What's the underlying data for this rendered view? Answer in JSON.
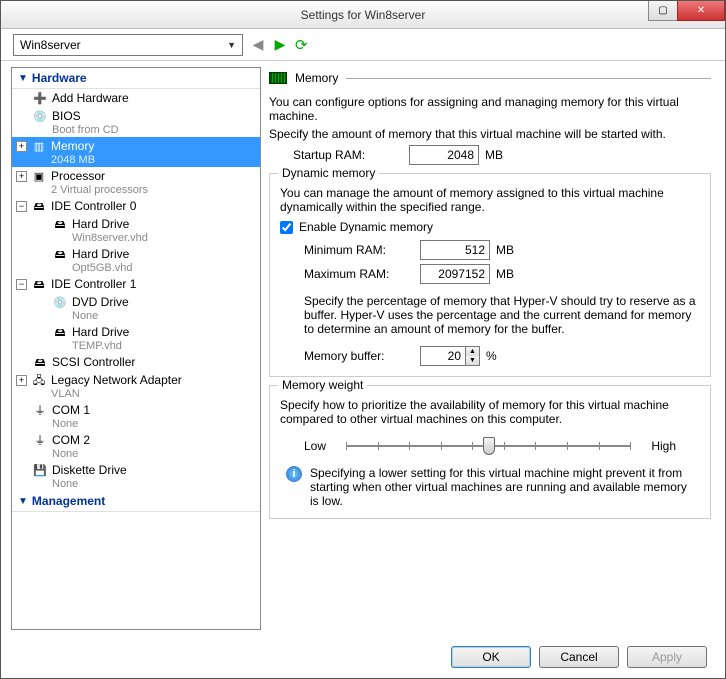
{
  "window": {
    "title": "Settings for Win8server"
  },
  "toolbar": {
    "vm_name": "Win8server"
  },
  "tree": {
    "hardware_label": "Hardware",
    "management_label": "Management",
    "add_hardware": "Add Hardware",
    "bios": "BIOS",
    "bios_sub": "Boot from CD",
    "memory": "Memory",
    "memory_sub": "2048 MB",
    "processor": "Processor",
    "processor_sub": "2 Virtual processors",
    "ide0": "IDE Controller 0",
    "hd1": "Hard Drive",
    "hd1_sub": "Win8server.vhd",
    "hd2": "Hard Drive",
    "hd2_sub": "Opt5GB.vhd",
    "ide1": "IDE Controller 1",
    "dvd": "DVD Drive",
    "dvd_sub": "None",
    "hd3": "Hard Drive",
    "hd3_sub": "TEMP.vhd",
    "scsi": "SCSI Controller",
    "net": "Legacy Network Adapter",
    "net_sub": "VLAN",
    "com1": "COM 1",
    "com1_sub": "None",
    "com2": "COM 2",
    "com2_sub": "None",
    "disk": "Diskette Drive",
    "disk_sub": "None"
  },
  "panel": {
    "title": "Memory",
    "intro": "You can configure options for assigning and managing memory for this virtual machine.",
    "specify": "Specify the amount of memory that this virtual machine will be started with.",
    "startup_label": "Startup RAM:",
    "startup_value": "2048",
    "mb": "MB",
    "dyn_title": "Dynamic memory",
    "dyn_desc": "You can manage the amount of memory assigned to this virtual machine dynamically within the specified range.",
    "dyn_enable": "Enable Dynamic memory",
    "min_label": "Minimum RAM:",
    "min_value": "512",
    "max_label": "Maximum RAM:",
    "max_value": "2097152",
    "buffer_desc": "Specify the percentage of memory that Hyper-V should try to reserve as a buffer. Hyper-V uses the percentage and the current demand for memory to determine an amount of memory for the buffer.",
    "buffer_label": "Memory buffer:",
    "buffer_value": "20",
    "pct": "%",
    "weight_title": "Memory weight",
    "weight_desc": "Specify how to prioritize the availability of memory for this virtual machine compared to other virtual machines on this computer.",
    "low": "Low",
    "high": "High",
    "info": "Specifying a lower setting for this virtual machine might prevent it from starting when other virtual machines are running and available memory is low."
  },
  "buttons": {
    "ok": "OK",
    "cancel": "Cancel",
    "apply": "Apply"
  }
}
